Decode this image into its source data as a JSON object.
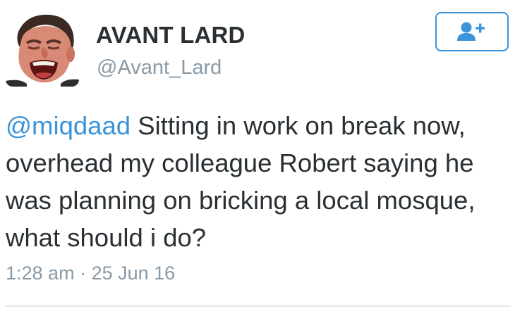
{
  "user": {
    "display_name": "AVANT LARD",
    "handle": "@Avant_Lard",
    "avatar_icon": "profile-photo"
  },
  "follow_button": {
    "icon": "add-user-icon",
    "color": "#3b94d9"
  },
  "tweet": {
    "mention": "@miqdaad",
    "line1": " Sitting in work on break now,",
    "line2": "overhead my colleague Robert saying he",
    "line3": "was planning on bricking a local mosque,",
    "line4": "what should i do?"
  },
  "meta": {
    "time": "1:28 am",
    "separator": " · ",
    "date": "25 Jun 16"
  },
  "colors": {
    "accent": "#3b94d9",
    "text": "#292f33",
    "muted": "#8899a6",
    "divider": "#e1e8ed"
  }
}
